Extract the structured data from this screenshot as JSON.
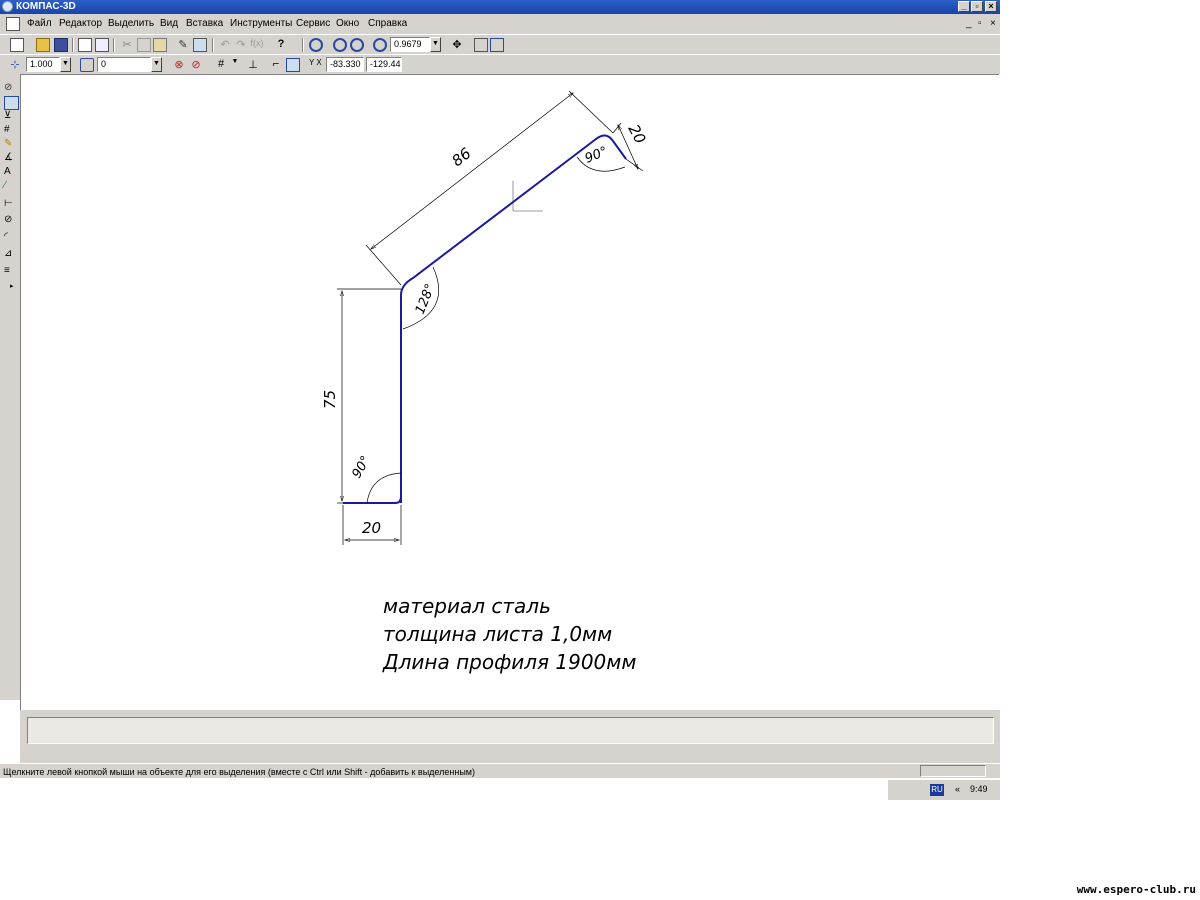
{
  "window": {
    "title": "КОМПАС-3D",
    "buttons": {
      "minimize": "_",
      "restore": "▫",
      "close": "×"
    }
  },
  "menu": {
    "items": [
      "Файл",
      "Редактор",
      "Выделить",
      "Вид",
      "Вставка",
      "Инструменты",
      "Сервис",
      "Окно",
      "Справка"
    ],
    "doc_buttons": {
      "minimize": "_",
      "restore": "▫",
      "close": "×"
    }
  },
  "toolbar": {
    "zoom_value": "0.9679"
  },
  "toolbar2": {
    "step_value": "1.000",
    "layer_value": "0",
    "coord_x": "-83.330",
    "coord_y": "-129.44"
  },
  "drawing": {
    "dim_86": "86",
    "dim_20_top": "20",
    "dim_75": "75",
    "dim_20_bottom": "20",
    "angle_128": "128°",
    "angle_90_top": "90°",
    "angle_90_bottom": "90°",
    "notes": [
      "материал сталь",
      "толщина листа 1,0мм",
      "Длина профиля 1900мм"
    ],
    "colors": {
      "profile": "#1a1aa0",
      "dimension": "#000000",
      "axis": "#7a7a7a"
    }
  },
  "status": {
    "hint": "Щелкните левой кнопкой мыши на объекте для его выделения (вместе с Ctrl или Shift - добавить к выделенным)"
  },
  "taskbar": {
    "lang": "RU",
    "arrows": "«",
    "clock": "9:49"
  },
  "watermark": "www.espero-club.ru"
}
